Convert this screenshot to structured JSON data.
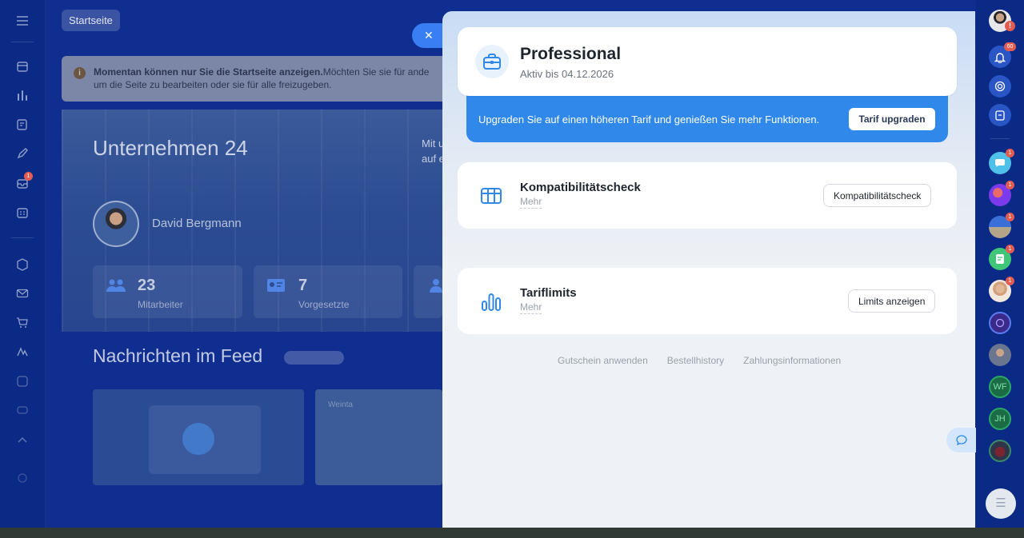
{
  "left_sidebar": {
    "badge_count": "1"
  },
  "home_tab": {
    "label": "Startseite"
  },
  "notice": {
    "bold": "Momentan können nur Sie die Startseite anzeigen.",
    "text": "Möchten Sie sie für ande",
    "text2": "um die Seite zu bearbeiten oder sie für alle freizugeben."
  },
  "hero": {
    "title": "Unternehmen 24",
    "side_line1": "Mit u",
    "side_line2": "auf e",
    "user_name": "David Bergmann"
  },
  "stats": [
    {
      "value": "23",
      "label": "Mitarbeiter"
    },
    {
      "value": "7",
      "label": "Vorgesetzte"
    }
  ],
  "feed": {
    "title": "Nachrichten im Feed",
    "card2_label": "Weinta"
  },
  "panel": {
    "plan": {
      "name": "Professional",
      "active_until": "Aktiv bis 04.12.2026"
    },
    "upgrade": {
      "text": "Upgraden Sie auf einen höheren Tarif und genießen Sie mehr Funktionen.",
      "button": "Tarif upgraden"
    },
    "compat": {
      "title": "Kompatibilitätscheck",
      "sub": "Mehr",
      "button": "Kompatibilitätscheck"
    },
    "limits": {
      "title": "Tariflimits",
      "sub": "Mehr",
      "button": "Limits anzeigen"
    },
    "footer_links": [
      "Gutschein anwenden",
      "Bestellhistory",
      "Zahlungsinformationen"
    ]
  },
  "right_sidebar": {
    "notifications_count": "60",
    "user_badge": "!",
    "chat_badges": [
      "1",
      "1",
      "1",
      "1",
      "1"
    ],
    "initials": [
      "WF",
      "JH"
    ]
  },
  "colors": {
    "accent": "#2f88ea",
    "badge": "#e25c52",
    "app_background": "#0f2e8f"
  }
}
